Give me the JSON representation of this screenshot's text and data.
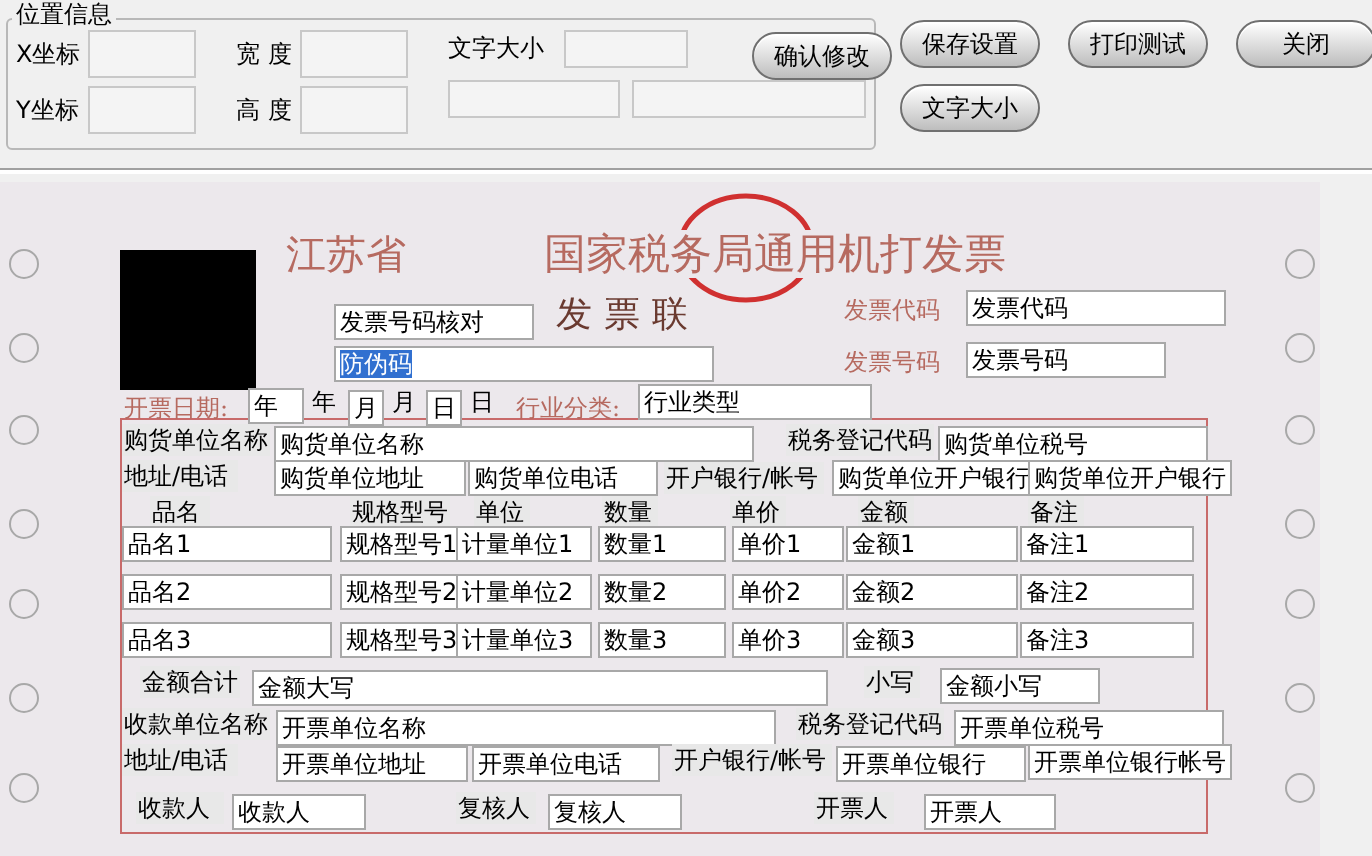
{
  "position_panel": {
    "title": "位置信息",
    "x_label": "X坐标",
    "y_label": "Y坐标",
    "width_label": "宽 度",
    "height_label": "高 度",
    "font_size_label": "文字大小",
    "confirm_button": "确认修改"
  },
  "buttons": [
    "保存设置",
    "打印测试",
    "关闭",
    "文字大小"
  ],
  "invoice": {
    "province": "江苏省",
    "title": "国家税务局通用机打发票",
    "copy_name": "发票联",
    "date_label": "开票日期:",
    "industry_label": "行业分类:",
    "code_label": "发票代码",
    "number_label": "发票号码",
    "items": [
      {
        "kind": "field",
        "text": "发票号码核对",
        "selected": false
      },
      {
        "kind": "field",
        "text": "防伪码",
        "selected": true
      },
      {
        "kind": "field",
        "text": "发票代码",
        "selected": false
      },
      {
        "kind": "field",
        "text": "发票号码",
        "selected": false
      },
      {
        "kind": "field",
        "text": "年",
        "selected": false
      },
      {
        "kind": "plain",
        "text": "年"
      },
      {
        "kind": "field",
        "text": "月",
        "selected": false
      },
      {
        "kind": "plain",
        "text": "月"
      },
      {
        "kind": "field",
        "text": "日",
        "selected": false
      },
      {
        "kind": "plain",
        "text": "日"
      },
      {
        "kind": "field",
        "text": "行业类型",
        "selected": false
      },
      {
        "kind": "label",
        "text": "购货单位名称"
      },
      {
        "kind": "field",
        "text": "购货单位名称",
        "selected": false
      },
      {
        "kind": "label",
        "text": "税务登记代码"
      },
      {
        "kind": "field",
        "text": "购货单位税号",
        "selected": false
      },
      {
        "kind": "label",
        "text": "地址/电话"
      },
      {
        "kind": "field",
        "text": "购货单位地址",
        "selected": false
      },
      {
        "kind": "field",
        "text": "购货单位电话",
        "selected": false
      },
      {
        "kind": "label",
        "text": "开户银行/帐号"
      },
      {
        "kind": "field",
        "text": "购货单位开户银行",
        "selected": false
      },
      {
        "kind": "field",
        "text": "购货单位开户银行",
        "selected": false
      },
      {
        "kind": "label",
        "text": "品名"
      },
      {
        "kind": "label",
        "text": "规格型号"
      },
      {
        "kind": "label",
        "text": "单位"
      },
      {
        "kind": "label",
        "text": "数量"
      },
      {
        "kind": "label",
        "text": "单价"
      },
      {
        "kind": "label",
        "text": "金额"
      },
      {
        "kind": "label",
        "text": "备注"
      },
      {
        "kind": "field",
        "text": "品名1",
        "selected": false
      },
      {
        "kind": "field",
        "text": "规格型号1",
        "selected": false
      },
      {
        "kind": "field",
        "text": "计量单位1",
        "selected": false
      },
      {
        "kind": "field",
        "text": "数量1",
        "selected": false
      },
      {
        "kind": "field",
        "text": "单价1",
        "selected": false
      },
      {
        "kind": "field",
        "text": "金额1",
        "selected": false
      },
      {
        "kind": "field",
        "text": "备注1",
        "selected": false
      },
      {
        "kind": "field",
        "text": "品名2",
        "selected": false
      },
      {
        "kind": "field",
        "text": "规格型号2",
        "selected": false
      },
      {
        "kind": "field",
        "text": "计量单位2",
        "selected": false
      },
      {
        "kind": "field",
        "text": "数量2",
        "selected": false
      },
      {
        "kind": "field",
        "text": "单价2",
        "selected": false
      },
      {
        "kind": "field",
        "text": "金额2",
        "selected": false
      },
      {
        "kind": "field",
        "text": "备注2",
        "selected": false
      },
      {
        "kind": "field",
        "text": "品名3",
        "selected": false
      },
      {
        "kind": "field",
        "text": "规格型号3",
        "selected": false
      },
      {
        "kind": "field",
        "text": "计量单位3",
        "selected": false
      },
      {
        "kind": "field",
        "text": "数量3",
        "selected": false
      },
      {
        "kind": "field",
        "text": "单价3",
        "selected": false
      },
      {
        "kind": "field",
        "text": "金额3",
        "selected": false
      },
      {
        "kind": "field",
        "text": "备注3",
        "selected": false
      },
      {
        "kind": "label",
        "text": "金额合计"
      },
      {
        "kind": "field",
        "text": "金额大写",
        "selected": false
      },
      {
        "kind": "label",
        "text": "小写"
      },
      {
        "kind": "field",
        "text": "金额小写",
        "selected": false
      },
      {
        "kind": "label",
        "text": "收款单位名称"
      },
      {
        "kind": "field",
        "text": "开票单位名称",
        "selected": false
      },
      {
        "kind": "label",
        "text": "税务登记代码"
      },
      {
        "kind": "field",
        "text": "开票单位税号",
        "selected": false
      },
      {
        "kind": "label",
        "text": "地址/电话"
      },
      {
        "kind": "field",
        "text": "开票单位地址",
        "selected": false
      },
      {
        "kind": "field",
        "text": "开票单位电话",
        "selected": false
      },
      {
        "kind": "label",
        "text": "开户银行/帐号"
      },
      {
        "kind": "field",
        "text": "开票单位银行",
        "selected": false
      },
      {
        "kind": "field",
        "text": "开票单位银行帐号",
        "selected": false
      },
      {
        "kind": "label",
        "text": "收款人"
      },
      {
        "kind": "field",
        "text": "收款人",
        "selected": false
      },
      {
        "kind": "label",
        "text": "复核人"
      },
      {
        "kind": "field",
        "text": "复核人",
        "selected": false
      },
      {
        "kind": "label",
        "text": "开票人"
      },
      {
        "kind": "field",
        "text": "开票人",
        "selected": false
      }
    ]
  }
}
